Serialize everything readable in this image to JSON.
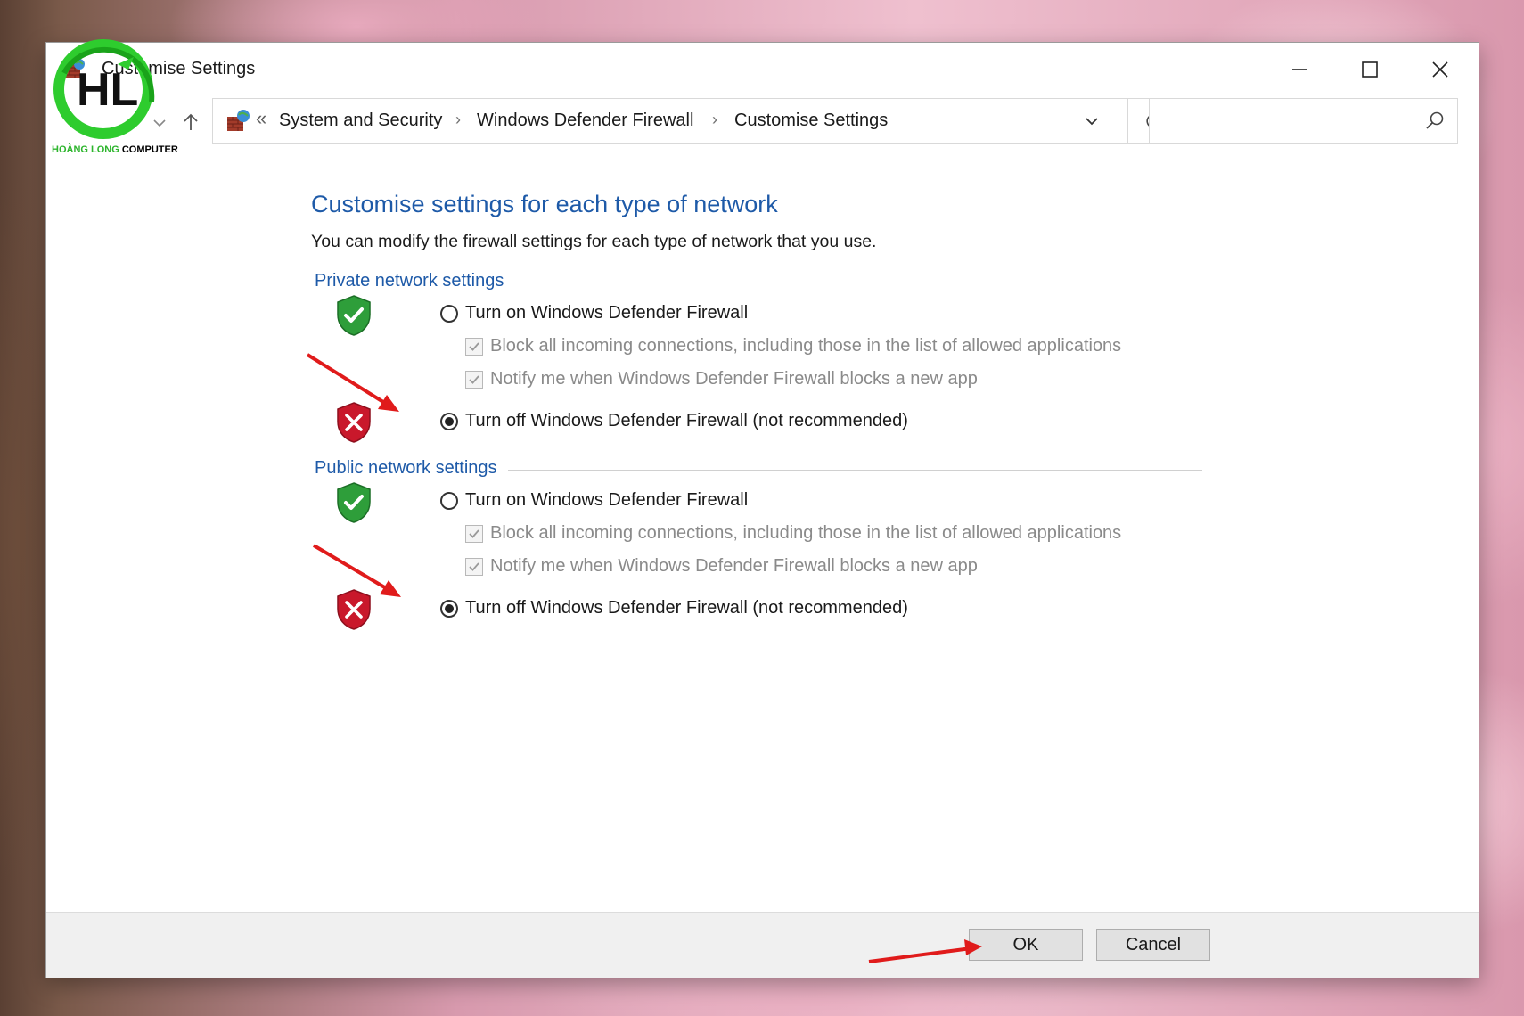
{
  "window": {
    "title": "Customise Settings"
  },
  "logo": {
    "brand_a": "HOÀNG LONG",
    "brand_b": "COMPUTER"
  },
  "address_bar": {
    "overflow_chevron": "«",
    "breadcrumbs": [
      "System and Security",
      "Windows Defender Firewall",
      "Customise Settings"
    ],
    "separator": "›"
  },
  "search": {
    "placeholder": ""
  },
  "main": {
    "heading": "Customise settings for each type of network",
    "description": "You can modify the firewall settings for each type of network that you use."
  },
  "private_section": {
    "title": "Private network settings",
    "turn_on_label": "Turn on Windows Defender Firewall",
    "block_label": "Block all incoming connections, including those in the list of allowed applications",
    "notify_label": "Notify me when Windows Defender Firewall blocks a new app",
    "turn_off_label": "Turn off Windows Defender Firewall (not recommended)",
    "selected": "off"
  },
  "public_section": {
    "title": "Public network settings",
    "turn_on_label": "Turn on Windows Defender Firewall",
    "block_label": "Block all incoming connections, including those in the list of allowed applications",
    "notify_label": "Notify me when Windows Defender Firewall blocks a new app",
    "turn_off_label": "Turn off Windows Defender Firewall (not recommended)",
    "selected": "off"
  },
  "footer": {
    "ok_label": "OK",
    "cancel_label": "Cancel"
  },
  "colors": {
    "heading_blue": "#1e5aa8",
    "shield_green": "#2e9e3a",
    "shield_red": "#c9182b",
    "annotation_arrow": "#e01b1b"
  }
}
